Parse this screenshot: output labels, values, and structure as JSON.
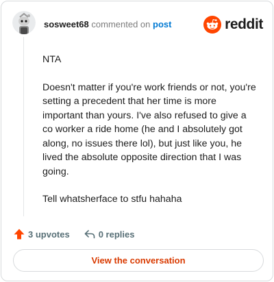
{
  "header": {
    "username": "sosweet68",
    "action_text": "commented on",
    "post_link": "post",
    "brand_name": "reddit"
  },
  "comment": {
    "paragraphs": [
      "NTA",
      "Doesn't matter if you're work friends or not, you're setting a precedent that her time is more important than yours. I've also refused to give a co worker a ride home (he and I absolutely got along, no issues there lol), but just like you, he lived the absolute opposite direction that I was going.",
      "Tell whatsherface to stfu hahaha"
    ]
  },
  "actions": {
    "upvotes": "3 upvotes",
    "replies": "0 replies"
  },
  "cta": {
    "label": "View the conversation"
  },
  "colors": {
    "brand_orange": "#ff4500",
    "link_blue": "#0079d3",
    "cta_text": "#d93a00",
    "muted": "#576f76"
  },
  "icons": {
    "avatar": "snoo-avatar-icon",
    "brand": "reddit-logo-icon",
    "upvote": "upvote-arrow-icon",
    "reply": "reply-arrow-icon"
  }
}
